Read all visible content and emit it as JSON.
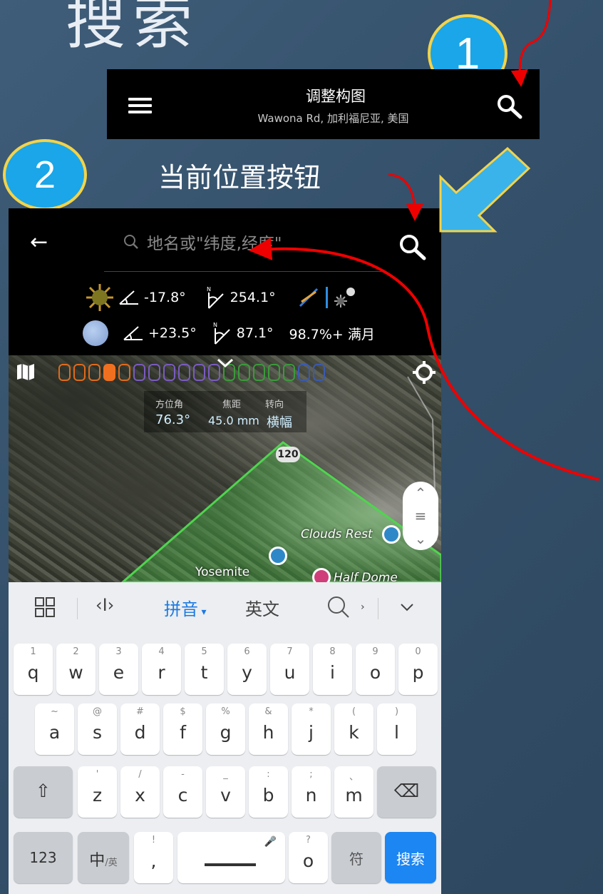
{
  "page_title": "搜索",
  "step1": "1",
  "step2": "2",
  "topbar": {
    "title": "调整构图",
    "subtitle": "Wawona Rd, 加利福尼亚, 美国"
  },
  "caption2": "当前位置按钮",
  "search": {
    "placeholder": "地名或\"纬度,经度\""
  },
  "sun_info": {
    "elevation": "-17.8°",
    "azimuth": "254.1°"
  },
  "moon_info": {
    "elevation": "+23.5°",
    "azimuth": "87.1°",
    "phase": "98.7%+ 满月"
  },
  "compass_n": "N",
  "map": {
    "azimuth_label": "方位角",
    "focal_label": "焦距",
    "orientation_label": "转向",
    "azimuth_value": "76.3°",
    "focal_value": "45.0 mm",
    "orientation_value": "横幅",
    "road": "120",
    "place1": "Clouds Rest",
    "place2": "Yosemite",
    "place3": "Half Dome"
  },
  "keyboard": {
    "toolbar": {
      "pinyin": "拼音",
      "english": "英文"
    },
    "row1": [
      {
        "n": "1",
        "c": "q"
      },
      {
        "n": "2",
        "c": "w"
      },
      {
        "n": "3",
        "c": "e"
      },
      {
        "n": "4",
        "c": "r"
      },
      {
        "n": "5",
        "c": "t"
      },
      {
        "n": "6",
        "c": "y"
      },
      {
        "n": "7",
        "c": "u"
      },
      {
        "n": "8",
        "c": "i"
      },
      {
        "n": "9",
        "c": "o"
      },
      {
        "n": "0",
        "c": "p"
      }
    ],
    "row2": [
      {
        "n": "~",
        "c": "a"
      },
      {
        "n": "@",
        "c": "s"
      },
      {
        "n": "#",
        "c": "d"
      },
      {
        "n": "$",
        "c": "f"
      },
      {
        "n": "%",
        "c": "g"
      },
      {
        "n": "&",
        "c": "h"
      },
      {
        "n": "*",
        "c": "j"
      },
      {
        "n": "(",
        "c": "k"
      },
      {
        "n": ")",
        "c": "l"
      }
    ],
    "row3": [
      {
        "n": "'",
        "c": "z"
      },
      {
        "n": "/",
        "c": "x"
      },
      {
        "n": "-",
        "c": "c"
      },
      {
        "n": "_",
        "c": "v"
      },
      {
        "n": ":",
        "c": "b"
      },
      {
        "n": ";",
        "c": "n"
      },
      {
        "n": "、",
        "c": "m"
      }
    ],
    "key_123": "123",
    "key_zh": "中",
    "key_zh_sub": "/英",
    "key_comma_top": "!",
    "key_comma": ",",
    "key_o_top": "?",
    "key_o": "o",
    "key_symbol": "符",
    "key_search": "搜索"
  }
}
